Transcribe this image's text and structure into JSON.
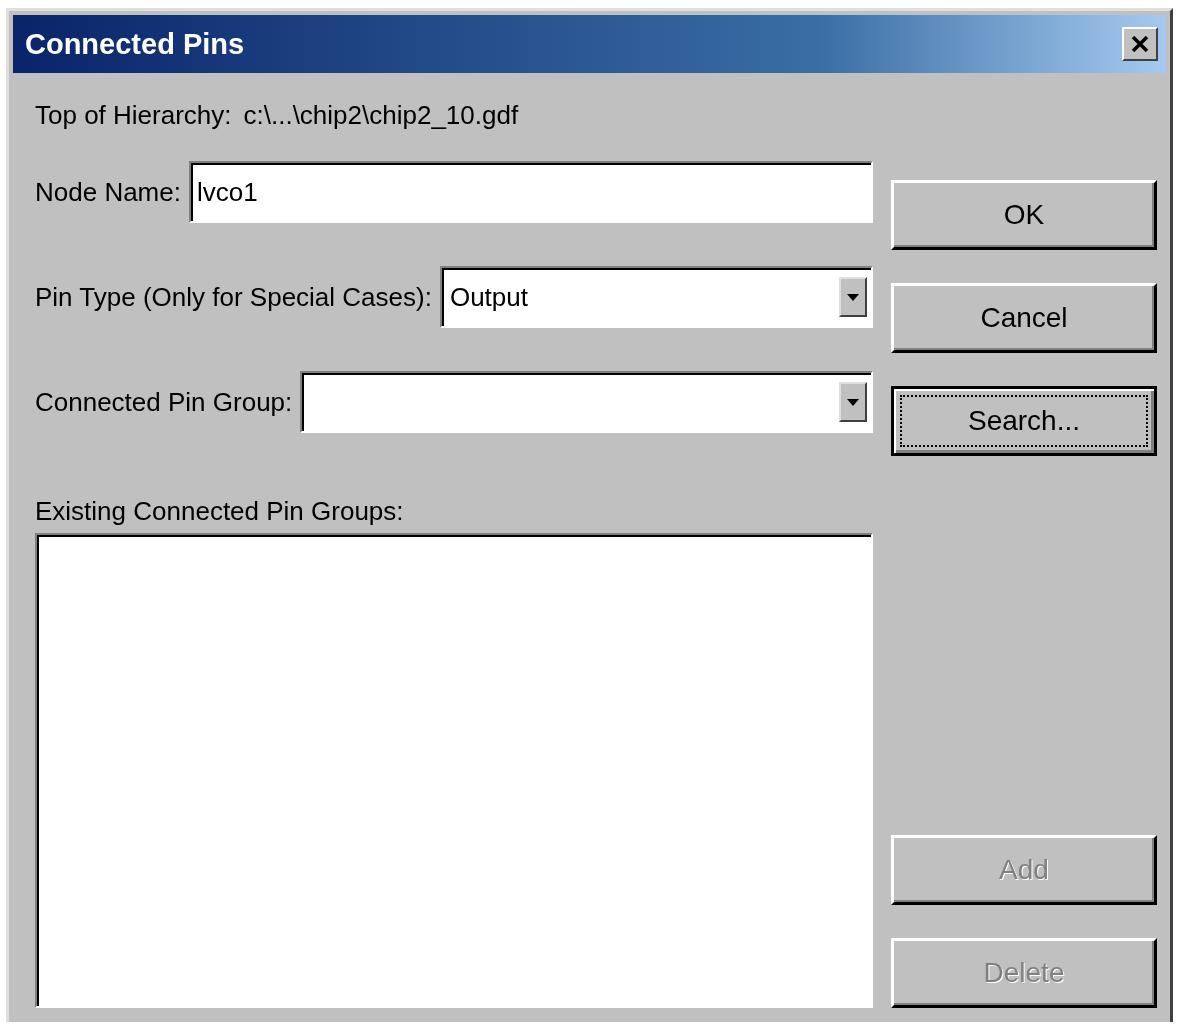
{
  "window": {
    "title": "Connected Pins"
  },
  "hierarchy": {
    "label": "Top of Hierarchy:",
    "path": "c:\\...\\chip2\\chip2_10.gdf"
  },
  "fields": [
    {
      "kind": "text",
      "label": "Node Name:",
      "value": "lvco1"
    },
    {
      "kind": "dropdown",
      "label": "Pin Type (Only for Special Cases):",
      "value": "Output"
    },
    {
      "kind": "dropdown",
      "label": "Connected Pin Group:"
    }
  ],
  "list": {
    "label": "Existing Connected Pin Groups:"
  },
  "buttons": [
    {
      "label": "OK",
      "disabled": false,
      "focused": false
    },
    {
      "label": "Cancel",
      "disabled": false,
      "focused": false
    },
    {
      "label": "Search...",
      "disabled": false,
      "focused": true
    },
    {
      "label": "Add",
      "disabled": true,
      "focused": false
    },
    {
      "label": "Delete",
      "disabled": true,
      "focused": false
    }
  ]
}
